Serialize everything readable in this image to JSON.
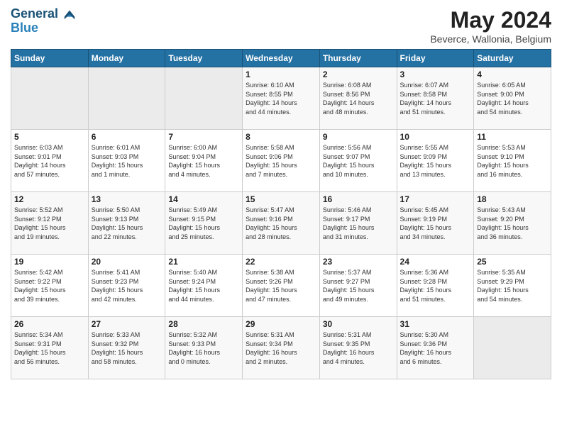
{
  "header": {
    "logo_line1": "General",
    "logo_line2": "Blue",
    "title": "May 2024",
    "subtitle": "Beverce, Wallonia, Belgium"
  },
  "days_of_week": [
    "Sunday",
    "Monday",
    "Tuesday",
    "Wednesday",
    "Thursday",
    "Friday",
    "Saturday"
  ],
  "weeks": [
    [
      {
        "num": "",
        "info": ""
      },
      {
        "num": "",
        "info": ""
      },
      {
        "num": "",
        "info": ""
      },
      {
        "num": "1",
        "info": "Sunrise: 6:10 AM\nSunset: 8:55 PM\nDaylight: 14 hours\nand 44 minutes."
      },
      {
        "num": "2",
        "info": "Sunrise: 6:08 AM\nSunset: 8:56 PM\nDaylight: 14 hours\nand 48 minutes."
      },
      {
        "num": "3",
        "info": "Sunrise: 6:07 AM\nSunset: 8:58 PM\nDaylight: 14 hours\nand 51 minutes."
      },
      {
        "num": "4",
        "info": "Sunrise: 6:05 AM\nSunset: 9:00 PM\nDaylight: 14 hours\nand 54 minutes."
      }
    ],
    [
      {
        "num": "5",
        "info": "Sunrise: 6:03 AM\nSunset: 9:01 PM\nDaylight: 14 hours\nand 57 minutes."
      },
      {
        "num": "6",
        "info": "Sunrise: 6:01 AM\nSunset: 9:03 PM\nDaylight: 15 hours\nand 1 minute."
      },
      {
        "num": "7",
        "info": "Sunrise: 6:00 AM\nSunset: 9:04 PM\nDaylight: 15 hours\nand 4 minutes."
      },
      {
        "num": "8",
        "info": "Sunrise: 5:58 AM\nSunset: 9:06 PM\nDaylight: 15 hours\nand 7 minutes."
      },
      {
        "num": "9",
        "info": "Sunrise: 5:56 AM\nSunset: 9:07 PM\nDaylight: 15 hours\nand 10 minutes."
      },
      {
        "num": "10",
        "info": "Sunrise: 5:55 AM\nSunset: 9:09 PM\nDaylight: 15 hours\nand 13 minutes."
      },
      {
        "num": "11",
        "info": "Sunrise: 5:53 AM\nSunset: 9:10 PM\nDaylight: 15 hours\nand 16 minutes."
      }
    ],
    [
      {
        "num": "12",
        "info": "Sunrise: 5:52 AM\nSunset: 9:12 PM\nDaylight: 15 hours\nand 19 minutes."
      },
      {
        "num": "13",
        "info": "Sunrise: 5:50 AM\nSunset: 9:13 PM\nDaylight: 15 hours\nand 22 minutes."
      },
      {
        "num": "14",
        "info": "Sunrise: 5:49 AM\nSunset: 9:15 PM\nDaylight: 15 hours\nand 25 minutes."
      },
      {
        "num": "15",
        "info": "Sunrise: 5:47 AM\nSunset: 9:16 PM\nDaylight: 15 hours\nand 28 minutes."
      },
      {
        "num": "16",
        "info": "Sunrise: 5:46 AM\nSunset: 9:17 PM\nDaylight: 15 hours\nand 31 minutes."
      },
      {
        "num": "17",
        "info": "Sunrise: 5:45 AM\nSunset: 9:19 PM\nDaylight: 15 hours\nand 34 minutes."
      },
      {
        "num": "18",
        "info": "Sunrise: 5:43 AM\nSunset: 9:20 PM\nDaylight: 15 hours\nand 36 minutes."
      }
    ],
    [
      {
        "num": "19",
        "info": "Sunrise: 5:42 AM\nSunset: 9:22 PM\nDaylight: 15 hours\nand 39 minutes."
      },
      {
        "num": "20",
        "info": "Sunrise: 5:41 AM\nSunset: 9:23 PM\nDaylight: 15 hours\nand 42 minutes."
      },
      {
        "num": "21",
        "info": "Sunrise: 5:40 AM\nSunset: 9:24 PM\nDaylight: 15 hours\nand 44 minutes."
      },
      {
        "num": "22",
        "info": "Sunrise: 5:38 AM\nSunset: 9:26 PM\nDaylight: 15 hours\nand 47 minutes."
      },
      {
        "num": "23",
        "info": "Sunrise: 5:37 AM\nSunset: 9:27 PM\nDaylight: 15 hours\nand 49 minutes."
      },
      {
        "num": "24",
        "info": "Sunrise: 5:36 AM\nSunset: 9:28 PM\nDaylight: 15 hours\nand 51 minutes."
      },
      {
        "num": "25",
        "info": "Sunrise: 5:35 AM\nSunset: 9:29 PM\nDaylight: 15 hours\nand 54 minutes."
      }
    ],
    [
      {
        "num": "26",
        "info": "Sunrise: 5:34 AM\nSunset: 9:31 PM\nDaylight: 15 hours\nand 56 minutes."
      },
      {
        "num": "27",
        "info": "Sunrise: 5:33 AM\nSunset: 9:32 PM\nDaylight: 15 hours\nand 58 minutes."
      },
      {
        "num": "28",
        "info": "Sunrise: 5:32 AM\nSunset: 9:33 PM\nDaylight: 16 hours\nand 0 minutes."
      },
      {
        "num": "29",
        "info": "Sunrise: 5:31 AM\nSunset: 9:34 PM\nDaylight: 16 hours\nand 2 minutes."
      },
      {
        "num": "30",
        "info": "Sunrise: 5:31 AM\nSunset: 9:35 PM\nDaylight: 16 hours\nand 4 minutes."
      },
      {
        "num": "31",
        "info": "Sunrise: 5:30 AM\nSunset: 9:36 PM\nDaylight: 16 hours\nand 6 minutes."
      },
      {
        "num": "",
        "info": ""
      }
    ]
  ]
}
